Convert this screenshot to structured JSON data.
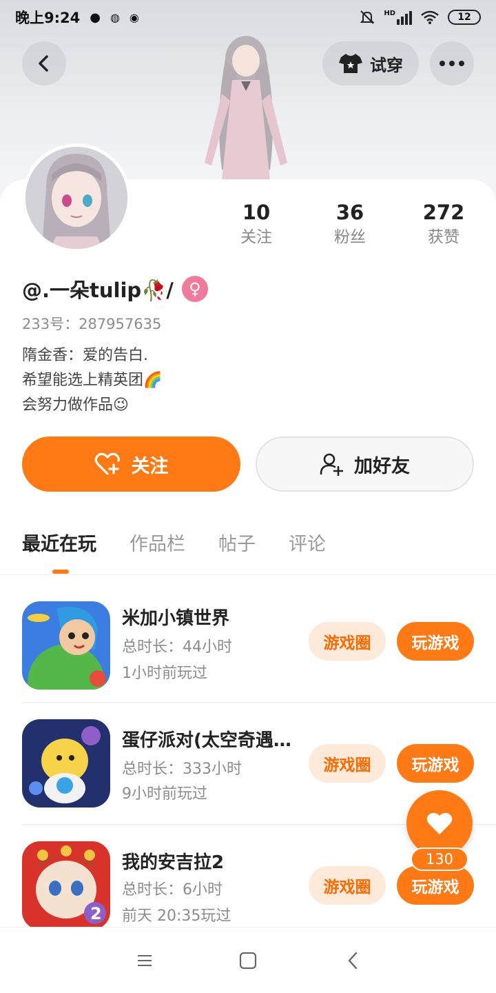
{
  "status_bar": {
    "time": "晚上9:24",
    "network": "HD",
    "battery": "12"
  },
  "header": {
    "tryon_label": "试穿"
  },
  "profile": {
    "stats": [
      {
        "value": "10",
        "label": "关注"
      },
      {
        "value": "36",
        "label": "粉丝"
      },
      {
        "value": "272",
        "label": "获赞"
      }
    ],
    "username": "@.一朵tulip🥀/",
    "gender_symbol": "♀",
    "uid": "233号：287957635",
    "bio": [
      "隋金香：爱的告白.",
      "希望能选上精英团🌈",
      "会努力做作品😉"
    ]
  },
  "actions": {
    "follow_label": "关注",
    "add_friend_label": "加好友"
  },
  "tabs": [
    "最近在玩",
    "作品栏",
    "帖子",
    "评论"
  ],
  "games": [
    {
      "title": "米加小镇世界",
      "duration": "总时长：44小时",
      "last_played": "1小时前玩过",
      "circle_label": "游戏圈",
      "play_label": "玩游戏"
    },
    {
      "title": "蛋仔派对(太空奇遇…",
      "duration": "总时长：333小时",
      "last_played": "9小时前玩过",
      "circle_label": "游戏圈",
      "play_label": "玩游戏"
    },
    {
      "title": "我的安吉拉2",
      "duration": "总时长：6小时",
      "last_played": "前天 20:35玩过",
      "circle_label": "游戏圈",
      "play_label": "玩游戏"
    }
  ],
  "like": {
    "count": "130"
  },
  "colors": {
    "accent": "#ff7a14",
    "circle_bg": "#ffe9d9",
    "gender": "#f07a9c"
  },
  "icons": [
    "back-icon",
    "shirt-icon",
    "more-icon",
    "heart-plus-icon",
    "add-user-icon",
    "heart-icon",
    "menu-icon",
    "home-icon",
    "nav-back-icon"
  ]
}
